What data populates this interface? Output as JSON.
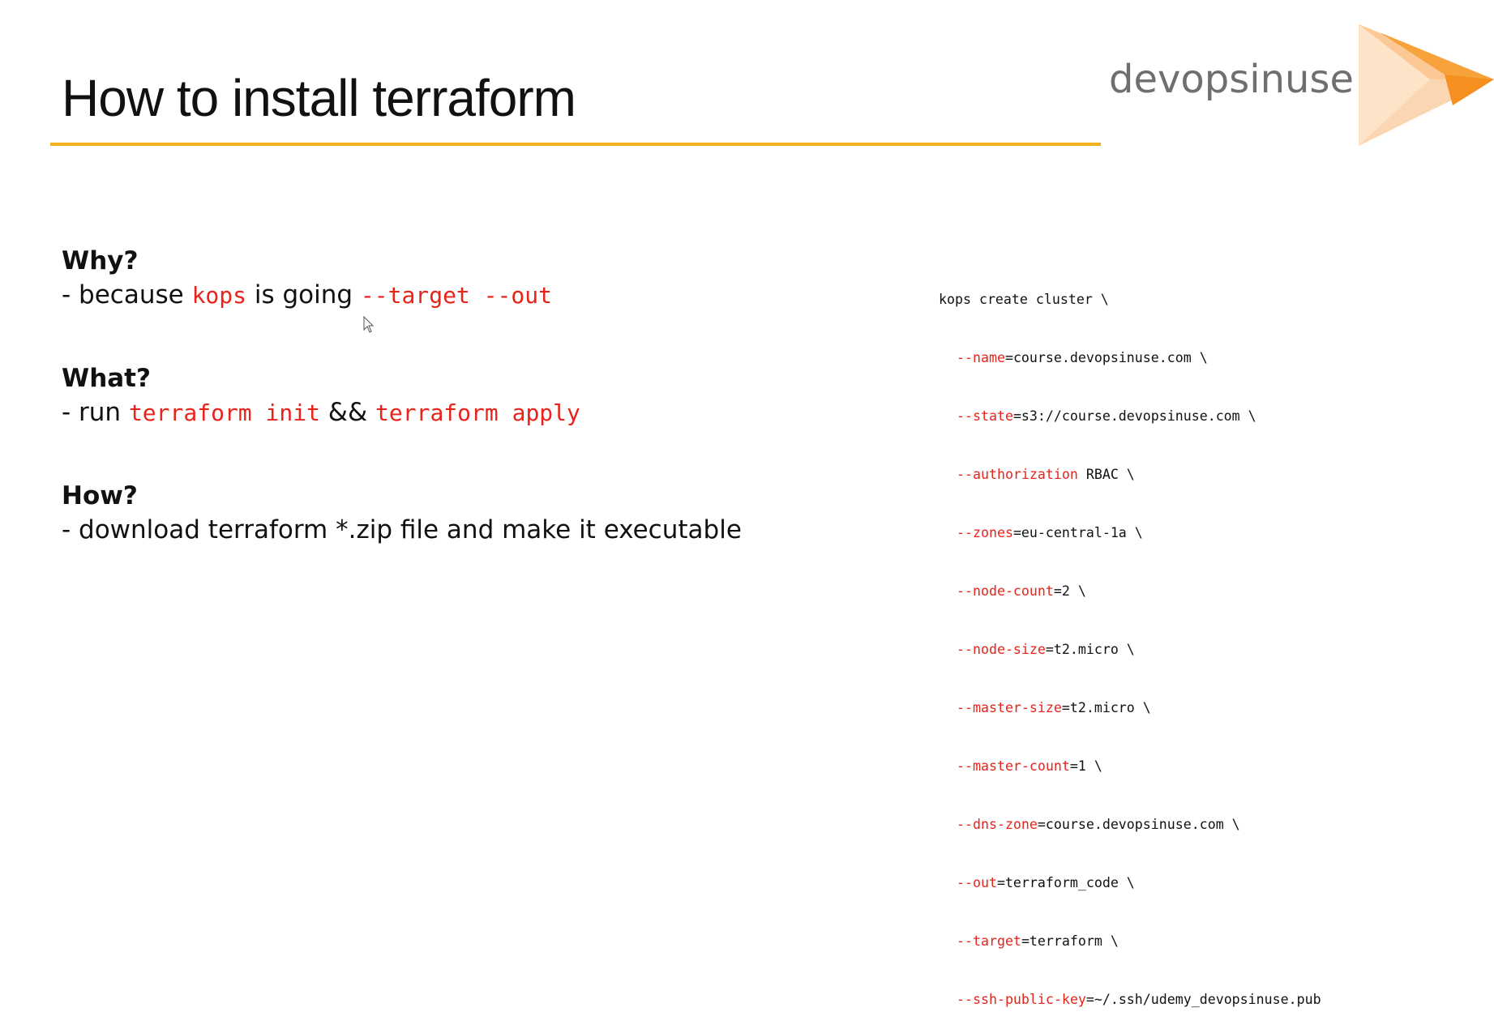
{
  "title": "How to install terraform",
  "logo": {
    "text": "devopsinuse",
    "accent_color": "#f7a23b",
    "rule_color": "#f2b01e"
  },
  "sections": [
    {
      "heading": "Why?",
      "line_prefix": "- because ",
      "code1": "kops",
      "middle": " is going ",
      "code2": "--target --out"
    },
    {
      "heading": "What?",
      "line_prefix": "- run ",
      "code1": "terraform init",
      "middle": " && ",
      "code2": "terraform apply"
    },
    {
      "heading": "How?",
      "line": "- download terraform *.zip file and make it executable"
    }
  ],
  "command": {
    "first_line": "kops create cluster \\",
    "options": [
      {
        "flag": "--name",
        "rest": "=course.devopsinuse.com \\"
      },
      {
        "flag": "--state",
        "rest": "=s3://course.devopsinuse.com \\"
      },
      {
        "flag": "--authorization",
        "rest": " RBAC \\"
      },
      {
        "flag": "--zones",
        "rest": "=eu-central-1a \\"
      },
      {
        "flag": "--node-count",
        "rest": "=2 \\"
      },
      {
        "flag": "--node-size",
        "rest": "=t2.micro \\"
      },
      {
        "flag": "--master-size",
        "rest": "=t2.micro \\"
      },
      {
        "flag": "--master-count",
        "rest": "=1 \\"
      },
      {
        "flag": "--dns-zone",
        "rest": "=course.devopsinuse.com \\"
      },
      {
        "flag": "--out",
        "rest": "=terraform_code \\"
      },
      {
        "flag": "--target",
        "rest": "=terraform \\"
      },
      {
        "flag": "--ssh-public-key",
        "rest": "=~/.ssh/udemy_devopsinuse.pub"
      }
    ]
  },
  "icons": [
    "logo-triangle-icon",
    "mouse-cursor-icon"
  ]
}
